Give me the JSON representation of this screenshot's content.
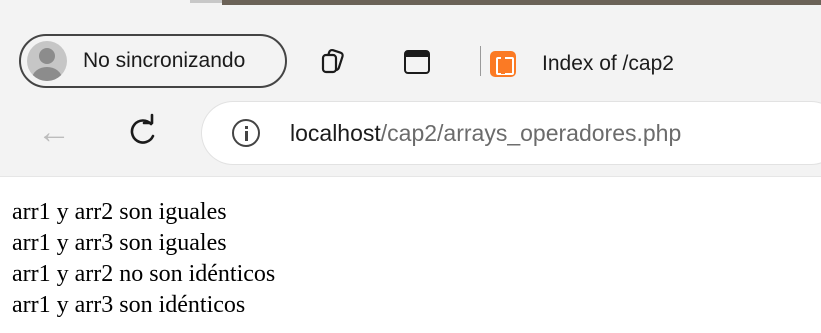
{
  "browser": {
    "profile_label": "No sincronizando",
    "tab_title": "Index of /cap2",
    "url": {
      "host": "localhost",
      "path": "/cap2/arrays_operadores.php"
    },
    "colors": {
      "favicon": "#fb7a24",
      "chrome_bg": "#f3f3f3"
    }
  },
  "page": {
    "lines": [
      "arr1 y arr2 son iguales",
      "arr1 y arr3 son iguales",
      "arr1 y arr2 no son idénticos",
      "arr1 y arr3 son idénticos"
    ]
  }
}
